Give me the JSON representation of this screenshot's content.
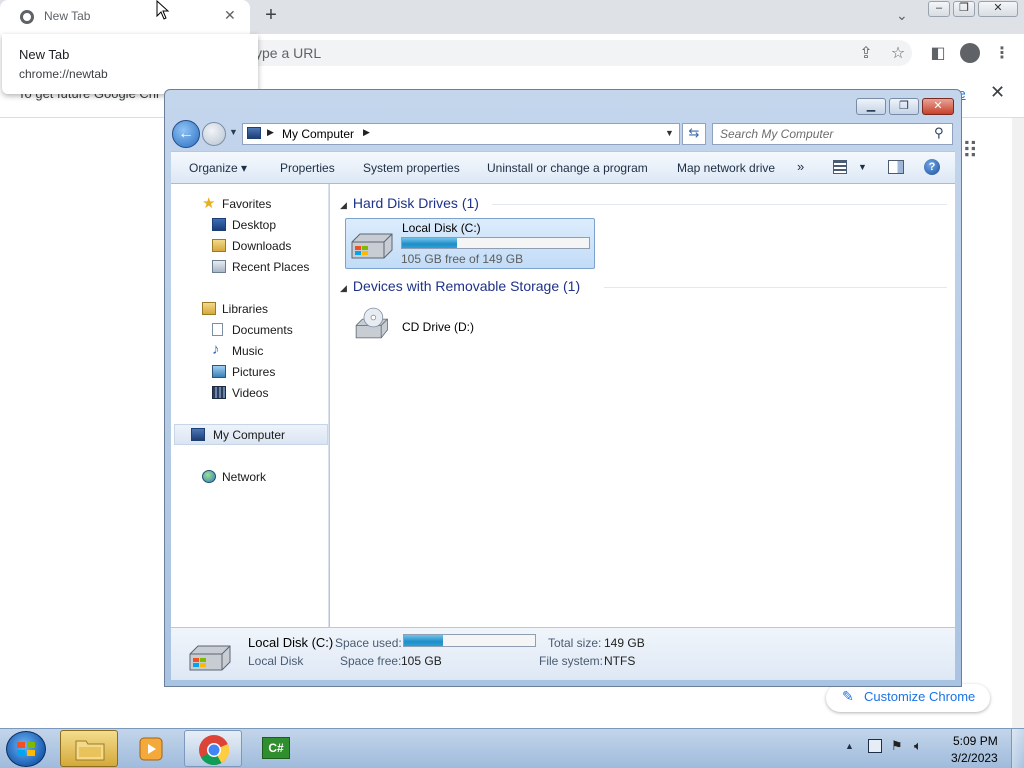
{
  "chrome": {
    "tab_title": "New Tab",
    "new_tab_symbol": "+",
    "omnibox_placeholder": "ype a URL",
    "infobar_text": "To get future Google Chr",
    "infobar_link": "re",
    "customize_label": "Customize Chrome",
    "hover_card": {
      "title": "New Tab",
      "url": "chrome://newtab"
    }
  },
  "explorer": {
    "address": "My Computer",
    "search_placeholder": "Search My Computer",
    "commands": [
      "Organize ▾",
      "Properties",
      "System properties",
      "Uninstall or change a program",
      "Map network drive"
    ],
    "more_symbol": "»",
    "nav": {
      "favorites": "Favorites",
      "desktop": "Desktop",
      "downloads": "Downloads",
      "recent_places": "Recent Places",
      "libraries": "Libraries",
      "documents": "Documents",
      "music": "Music",
      "pictures": "Pictures",
      "videos": "Videos",
      "my_computer": "My Computer",
      "network": "Network"
    },
    "groups": {
      "hdd_header": "Hard Disk Drives (1)",
      "removable_header": "Devices with Removable Storage (1)"
    },
    "drive_c": {
      "name": "Local Disk (C:)",
      "free_text": "105 GB free of 149 GB",
      "used_fraction": 0.295
    },
    "cd_drive": {
      "name": "CD Drive (D:)"
    },
    "details": {
      "name": "Local Disk (C:)",
      "type": "Local Disk",
      "space_used_label": "Space used:",
      "space_free_label": "Space free:",
      "space_free_value": "105 GB",
      "total_size_label": "Total size:",
      "total_size_value": "149 GB",
      "file_system_label": "File system:",
      "file_system_value": "NTFS",
      "used_fraction": 0.295
    }
  },
  "taskbar": {
    "time": "5:09 PM",
    "date": "3/2/2023",
    "csharp_label": "C#"
  }
}
